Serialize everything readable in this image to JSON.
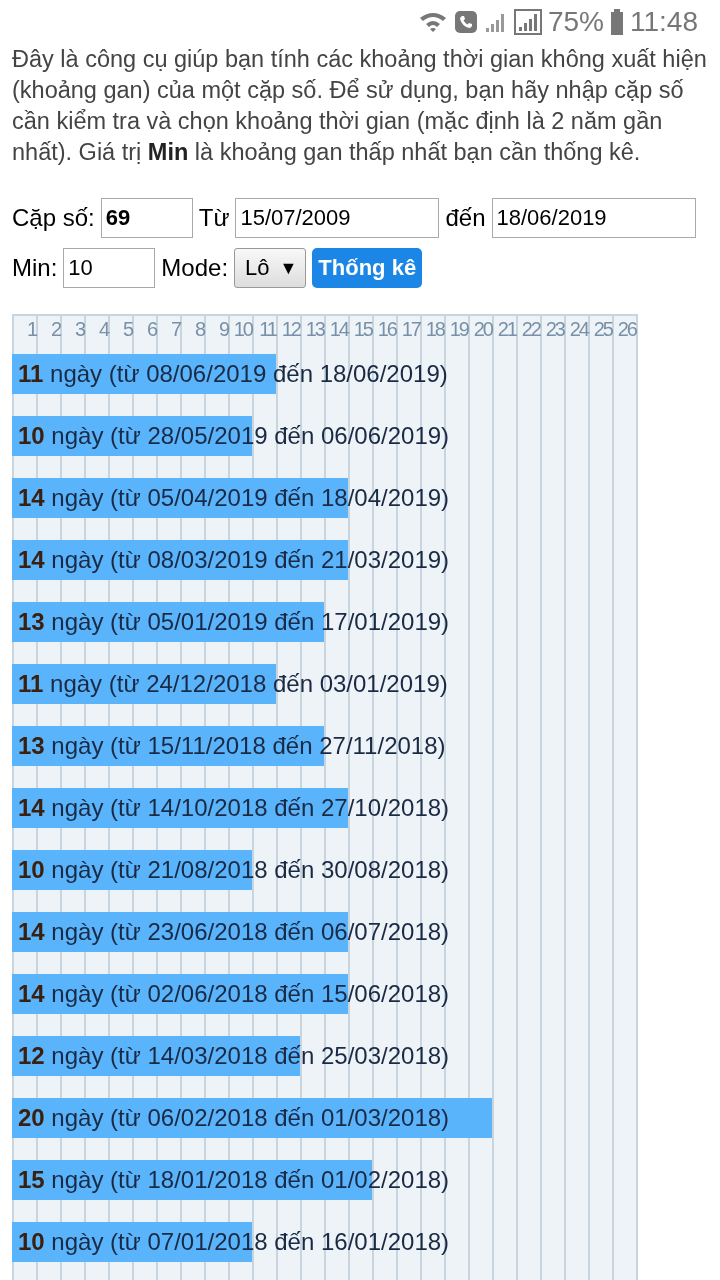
{
  "status_bar": {
    "battery_text": "75%",
    "time": "11:48"
  },
  "intro": "Đây là công cụ giúp bạn tính các khoảng thời gian không xuất hiện (khoảng gan) của một cặp số. Để sử dụng, bạn hãy nhập cặp số cần kiểm tra và chọn khoảng thời gian (mặc định là 2 năm gần nhất). Giá trị **Min** là khoảng gan thấp nhất bạn cần thống kê.",
  "form": {
    "pair_label": "Cặp số:",
    "pair_value": "69",
    "from_label": "Từ",
    "from_value": "15/07/2009",
    "to_label": "đến",
    "to_value": "18/06/2019",
    "min_label": "Min:",
    "min_value": "10",
    "mode_label": "Mode:",
    "mode_value": "Lô",
    "mode_caret": "▼",
    "submit": "Thống kê"
  },
  "grid_header": [
    "1",
    "2",
    "3",
    "4",
    "5",
    "6",
    "7",
    "8",
    "9",
    "10",
    "11",
    "12",
    "13",
    "14",
    "15",
    "16",
    "17",
    "18",
    "19",
    "20",
    "21",
    "22",
    "23",
    "24",
    "25",
    "26"
  ],
  "rows": [
    {
      "days": "11",
      "text": "ngày (từ 08/06/2019 đến 18/06/2019)",
      "level": 0.4231
    },
    {
      "days": "10",
      "text": "ngày (từ 28/05/2019 đến 06/06/2019)",
      "level": 0.3846
    },
    {
      "days": "14",
      "text": "ngày (từ 05/04/2019 đến 18/04/2019)",
      "level": 0.5385
    },
    {
      "days": "14",
      "text": "ngày (từ 08/03/2019 đến 21/03/2019)",
      "level": 0.5385
    },
    {
      "days": "13",
      "text": "ngày (từ 05/01/2019 đến 17/01/2019)",
      "level": 0.5
    },
    {
      "days": "11",
      "text": "ngày (từ 24/12/2018 đến 03/01/2019)",
      "level": 0.4231
    },
    {
      "days": "13",
      "text": "ngày (từ 15/11/2018 đến 27/11/2018)",
      "level": 0.5
    },
    {
      "days": "14",
      "text": "ngày (từ 14/10/2018 đến 27/10/2018)",
      "level": 0.5385
    },
    {
      "days": "10",
      "text": "ngày (từ 21/08/2018 đến 30/08/2018)",
      "level": 0.3846
    },
    {
      "days": "14",
      "text": "ngày (từ 23/06/2018 đến 06/07/2018)",
      "level": 0.5385
    },
    {
      "days": "14",
      "text": "ngày (từ 02/06/2018 đến 15/06/2018)",
      "level": 0.5385
    },
    {
      "days": "12",
      "text": "ngày (từ 14/03/2018 đến 25/03/2018)",
      "level": 0.4615
    },
    {
      "days": "20",
      "text": "ngày (từ 06/02/2018 đến 01/03/2018)",
      "level": 0.7692
    },
    {
      "days": "15",
      "text": "ngày (từ 18/01/2018 đến 01/02/2018)",
      "level": 0.5769
    },
    {
      "days": "10",
      "text": "ngày (từ 07/01/2018 đến 16/01/2018)",
      "level": 0.3846
    }
  ]
}
